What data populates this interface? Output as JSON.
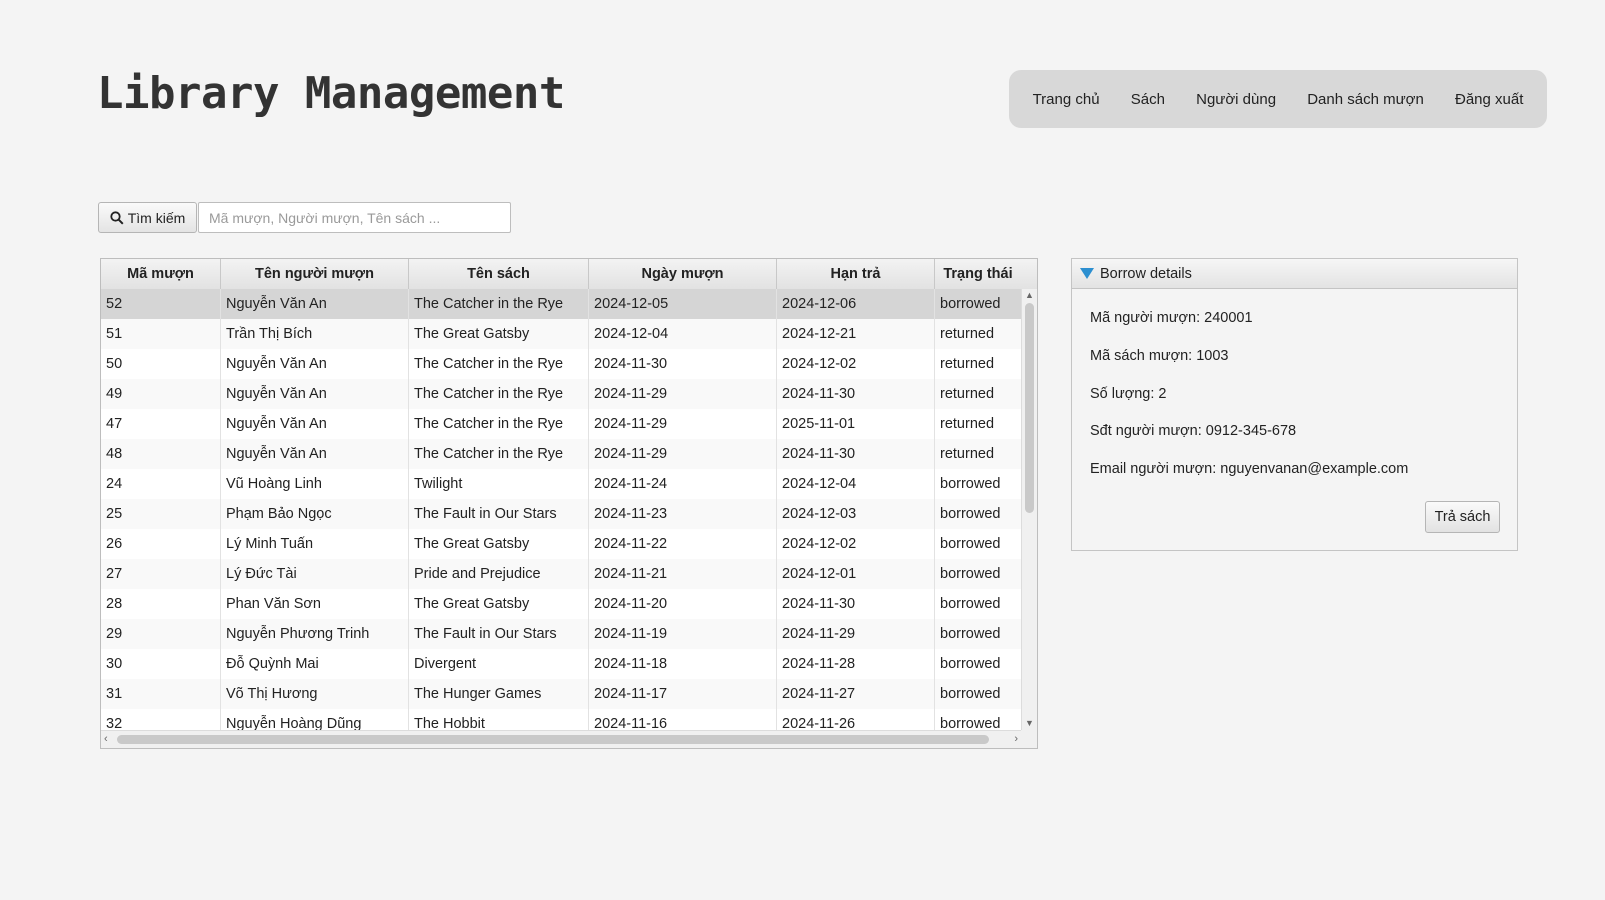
{
  "app": {
    "title": "Library Management"
  },
  "nav": {
    "items": [
      "Trang chủ",
      "Sách",
      "Người dùng",
      "Danh sách mượn",
      "Đăng xuất"
    ]
  },
  "search": {
    "button_label": "Tìm kiếm",
    "button_icon": "search-icon",
    "placeholder": "Mã mượn, Người mượn, Tên sách ...",
    "value": ""
  },
  "table": {
    "columns": [
      "Mã mượn",
      "Tên người mượn",
      "Tên sách",
      "Ngày mượn",
      "Hạn trả",
      "Trạng thái"
    ],
    "selected_index": 0,
    "rows": [
      [
        "52",
        "Nguyễn Văn An",
        "The Catcher in the Rye",
        "2024-12-05",
        "2024-12-06",
        "borrowed"
      ],
      [
        "51",
        "Trần Thị Bích",
        "The Great Gatsby",
        "2024-12-04",
        "2024-12-21",
        "returned"
      ],
      [
        "50",
        "Nguyễn Văn An",
        "The Catcher in the Rye",
        "2024-11-30",
        "2024-12-02",
        "returned"
      ],
      [
        "49",
        "Nguyễn Văn An",
        "The Catcher in the Rye",
        "2024-11-29",
        "2024-11-30",
        "returned"
      ],
      [
        "47",
        "Nguyễn Văn An",
        "The Catcher in the Rye",
        "2024-11-29",
        "2025-11-01",
        "returned"
      ],
      [
        "48",
        "Nguyễn Văn An",
        "The Catcher in the Rye",
        "2024-11-29",
        "2024-11-30",
        "returned"
      ],
      [
        "24",
        "Vũ Hoàng Linh",
        "Twilight",
        "2024-11-24",
        "2024-12-04",
        "borrowed"
      ],
      [
        "25",
        "Phạm Bảo Ngọc",
        "The Fault in Our Stars",
        "2024-11-23",
        "2024-12-03",
        "borrowed"
      ],
      [
        "26",
        "Lý Minh Tuấn",
        "The Great Gatsby",
        "2024-11-22",
        "2024-12-02",
        "borrowed"
      ],
      [
        "27",
        "Lý Đức Tài",
        "Pride and Prejudice",
        "2024-11-21",
        "2024-12-01",
        "borrowed"
      ],
      [
        "28",
        "Phan Văn Sơn",
        "The Great Gatsby",
        "2024-11-20",
        "2024-11-30",
        "borrowed"
      ],
      [
        "29",
        "Nguyễn Phương Trinh",
        "The Fault in Our Stars",
        "2024-11-19",
        "2024-11-29",
        "borrowed"
      ],
      [
        "30",
        "Đỗ Quỳnh Mai",
        "Divergent",
        "2024-11-18",
        "2024-11-28",
        "borrowed"
      ],
      [
        "31",
        "Võ Thị Hương",
        "The Hunger Games",
        "2024-11-17",
        "2024-11-27",
        "borrowed"
      ],
      [
        "32",
        "Nguyễn Hoàng Dũng",
        "The Hobbit",
        "2024-11-16",
        "2024-11-26",
        "borrowed"
      ]
    ]
  },
  "details": {
    "title": "Borrow details",
    "expanded": true,
    "borrower_id": "Mã người mượn: 240001",
    "book_id": "Mã sách mượn: 1003",
    "quantity": "Số lượng: 2",
    "phone": "Sđt người mượn: 0912-345-678",
    "email": "Email người mượn: nguyenvanan@example.com",
    "return_button": "Trả sách"
  },
  "colors": {
    "background": "#f4f4f4",
    "nav_background": "#d8d8d8",
    "selected_row": "#d5d5d5",
    "accent": "#2c8fd0"
  }
}
